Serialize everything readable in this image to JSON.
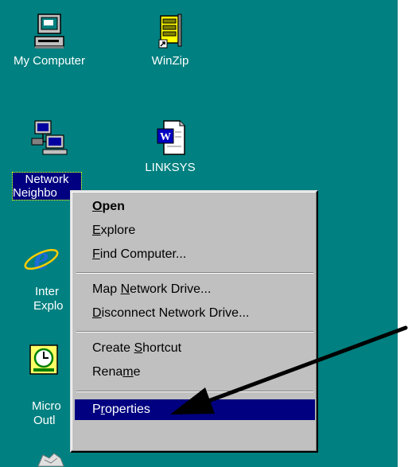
{
  "desktop": {
    "background": "#008080",
    "icons": [
      {
        "label": "My Computer",
        "icon": "computer-icon"
      },
      {
        "label": "WinZip",
        "icon": "winzip-icon"
      },
      {
        "label": "Network Neighborhood",
        "icon": "network-icon"
      },
      {
        "label": "LINKSYS",
        "icon": "word-document-icon"
      },
      {
        "label": "Internet Explorer",
        "icon": "internet-explorer-icon"
      },
      {
        "label": "Microsoft Outlook",
        "icon": "outlook-icon"
      }
    ],
    "selected_icon_label": {
      "line1": "Network",
      "line2": "Neighbo"
    },
    "partial_labels": {
      "ie_line1": "Inter",
      "ie_line2": "Explo",
      "outlook_line1": "Micro",
      "outlook_line2": "Outl"
    }
  },
  "context_menu": {
    "items": [
      {
        "pre": "",
        "ul": "O",
        "post": "pen",
        "default": true
      },
      {
        "pre": "",
        "ul": "E",
        "post": "xplore"
      },
      {
        "pre": "",
        "ul": "F",
        "post": "ind Computer..."
      },
      {
        "pre": "Map ",
        "ul": "N",
        "post": "etwork Drive..."
      },
      {
        "pre": "",
        "ul": "D",
        "post": "isconnect Network Drive..."
      },
      {
        "pre": "Create ",
        "ul": "S",
        "post": "hortcut"
      },
      {
        "pre": "Rena",
        "ul": "m",
        "post": "e"
      },
      {
        "pre": "P",
        "ul": "r",
        "post": "operties",
        "highlighted": true
      }
    ],
    "highlight_color": "#000080"
  },
  "annotation": {
    "arrow_color": "#000000"
  }
}
